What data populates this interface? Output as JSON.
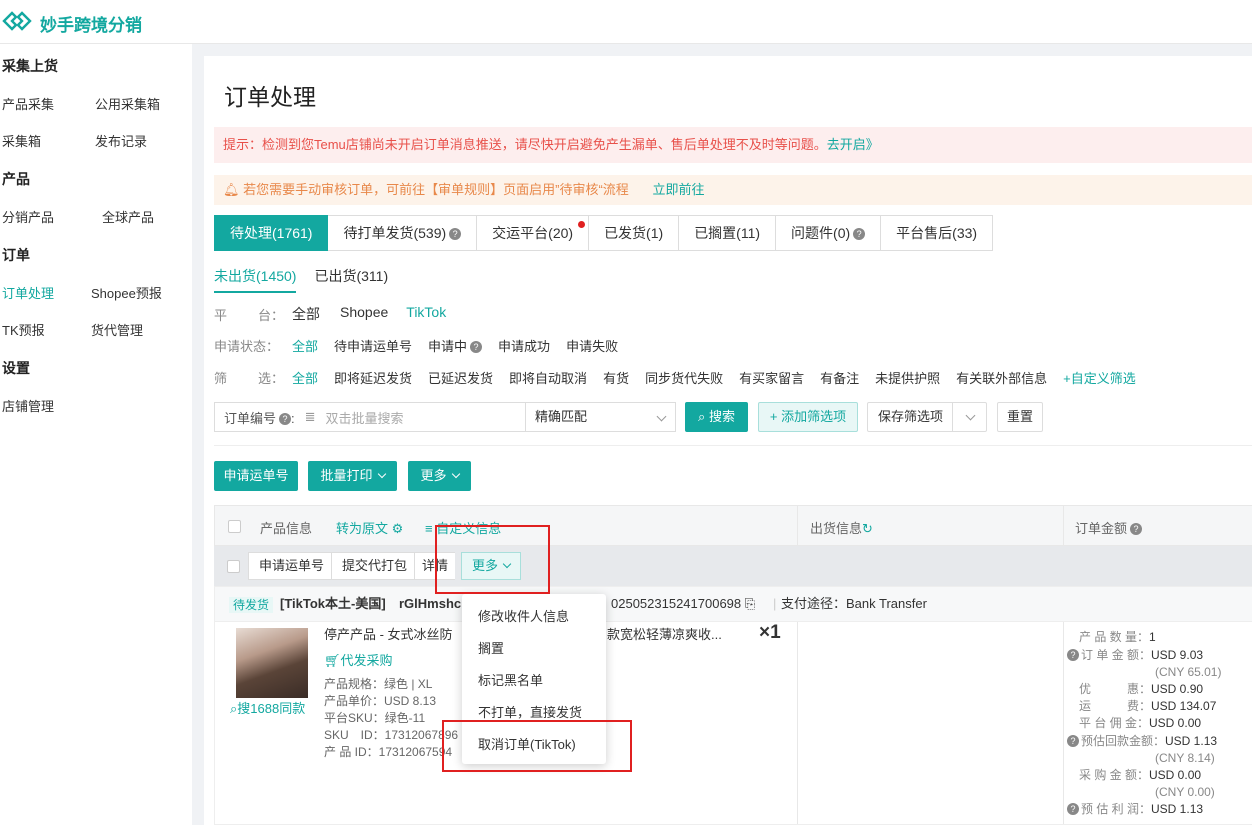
{
  "app": {
    "brand": "妙手跨境分销"
  },
  "sidebar": {
    "sections": [
      {
        "title": "采集上货",
        "items": [
          [
            "产品采集",
            "公用采集箱"
          ],
          [
            "采集箱",
            "发布记录"
          ]
        ]
      },
      {
        "title": "产品",
        "items": [
          [
            "分销产品",
            "全球产品"
          ]
        ]
      },
      {
        "title": "订单",
        "items": [
          [
            "订单处理",
            "Shopee预报"
          ],
          [
            "TK预报",
            "货代管理"
          ]
        ]
      },
      {
        "title": "设置",
        "items": [
          [
            "店铺管理"
          ]
        ]
      }
    ]
  },
  "page": {
    "title": "订单处理"
  },
  "alerts": {
    "tip_text": "提示：检测到您Temu店铺尚未开启订单消息推送，请尽快开启避免产生漏单、售后单处理不及时等问题。",
    "tip_link": "去开启》",
    "audit_text": "若您需要手动审核订单，可前往【审单规则】页面启用”待审核“流程",
    "audit_link": "立即前往"
  },
  "tabs": [
    "待处理(1761)",
    "待打单发货(539)",
    "交运平台(20)",
    "已发货(1)",
    "已搁置(11)",
    "问题件(0)",
    "平台售后(33)"
  ],
  "subtabs": [
    "未出货(1450)",
    "已出货(311)"
  ],
  "filters": {
    "platform_label": [
      "平",
      "台："
    ],
    "platforms": [
      "全部",
      "Shopee",
      "TikTok"
    ],
    "status_label": "申请状态：",
    "statuses": [
      "全部",
      "待申请运单号",
      "申请中",
      "申请成功",
      "申请失败"
    ],
    "screen_label": [
      "筛",
      "选："
    ],
    "screens": [
      "全部",
      "即将延迟发货",
      "已延迟发货",
      "即将自动取消",
      "有货",
      "同步货代失败",
      "有买家留言",
      "有备注",
      "未提供护照",
      "有关联外部信息",
      "+自定义筛选"
    ]
  },
  "search": {
    "label": "订单编号",
    "placeholder": "双击批量搜索",
    "match": "精确匹配",
    "search_btn": "搜索",
    "add_filter": "+ 添加筛选项",
    "save_filter": "保存筛选项",
    "reset": "重置"
  },
  "actions": {
    "apply": "申请运单号",
    "batch_print": "批量打印",
    "more": "更多"
  },
  "table": {
    "product_info": "产品信息",
    "to_original": "转为原文",
    "custom_info": "自定义信息",
    "shipping_info": "出货信息",
    "order_amount": "订单金额"
  },
  "row_actions": {
    "apply": "申请运单号",
    "submit_pack": "提交代打包",
    "detail": "详情",
    "more": "更多"
  },
  "order": {
    "status": "待发货",
    "store": "[TikTok本土-美国]",
    "buyer": "rGlHmshc",
    "order_no": "025052315241700698",
    "payment": "支付途径：Bank Transfer",
    "product_name": "停产产品 - 女式冰丝防",
    "product_name_tail": "款宽松轻薄凉爽收...",
    "qty": "×1",
    "proxy_purchase": "代发采购",
    "search_1688": "搜1688同款",
    "spec": "产品规格：绿色 | XL",
    "unit_price": "产品单价：USD 8.13",
    "platform_sku": "平台SKU：绿色-11",
    "sku_id": "SKU　ID：17312067896",
    "product_id": "产 品 ID：17312067594"
  },
  "summary": [
    {
      "label": "产 品 数 量：",
      "value": "1"
    },
    {
      "label": "订 单 金 额：",
      "value": "USD 9.03"
    },
    {
      "label": "",
      "value": "(CNY 65.01)"
    },
    {
      "label": "优　　　惠：",
      "value": "USD 0.90"
    },
    {
      "label": "运　　　费：",
      "value": "USD 134.07"
    },
    {
      "label": "平 台 佣 金：",
      "value": "USD 0.00"
    },
    {
      "label": "预估回款金额：",
      "value": "USD 1.13"
    },
    {
      "label": "",
      "value": "(CNY 8.14)"
    },
    {
      "label": "采 购 金 额：",
      "value": "USD 0.00"
    },
    {
      "label": "",
      "value": "(CNY 0.00)"
    },
    {
      "label": "预 估 利 润：",
      "value": "USD 1.13"
    }
  ],
  "dropdown": [
    "修改收件人信息",
    "搁置",
    "标记黑名单",
    "不打单，直接发货",
    "取消订单(TikTok)"
  ],
  "colors": {
    "accent": "#13a8a0",
    "danger": "#e02020"
  }
}
